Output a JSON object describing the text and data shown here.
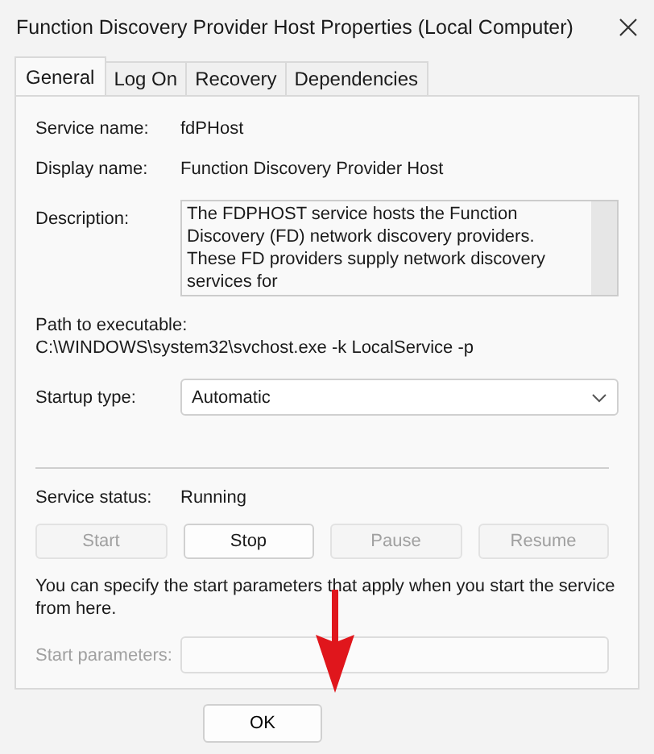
{
  "window": {
    "title": "Function Discovery Provider Host Properties (Local Computer)"
  },
  "tabs": [
    {
      "label": "General",
      "selected": true
    },
    {
      "label": "Log On",
      "selected": false
    },
    {
      "label": "Recovery",
      "selected": false
    },
    {
      "label": "Dependencies",
      "selected": false
    }
  ],
  "service_name": {
    "label": "Service name:",
    "value": "fdPHost"
  },
  "display_name": {
    "label": "Display name:",
    "value": "Function Discovery Provider Host"
  },
  "description": {
    "label": "Description:",
    "value": "The FDPHOST service hosts the Function Discovery (FD) network discovery providers. These FD providers supply network discovery services for"
  },
  "path": {
    "label": "Path to executable:",
    "value": "C:\\WINDOWS\\system32\\svchost.exe -k LocalService -p"
  },
  "startup_type": {
    "label": "Startup type:",
    "value": "Automatic"
  },
  "service_status": {
    "label": "Service status:",
    "value": "Running"
  },
  "control_buttons": [
    {
      "label": "Start",
      "disabled": true
    },
    {
      "label": "Stop",
      "disabled": false
    },
    {
      "label": "Pause",
      "disabled": true
    },
    {
      "label": "Resume",
      "disabled": true
    }
  ],
  "hint": "You can specify the start parameters that apply when you start the service from here.",
  "start_parameters": {
    "label": "Start parameters:",
    "disabled": true
  },
  "dialog_buttons": [
    {
      "label": "OK"
    }
  ]
}
